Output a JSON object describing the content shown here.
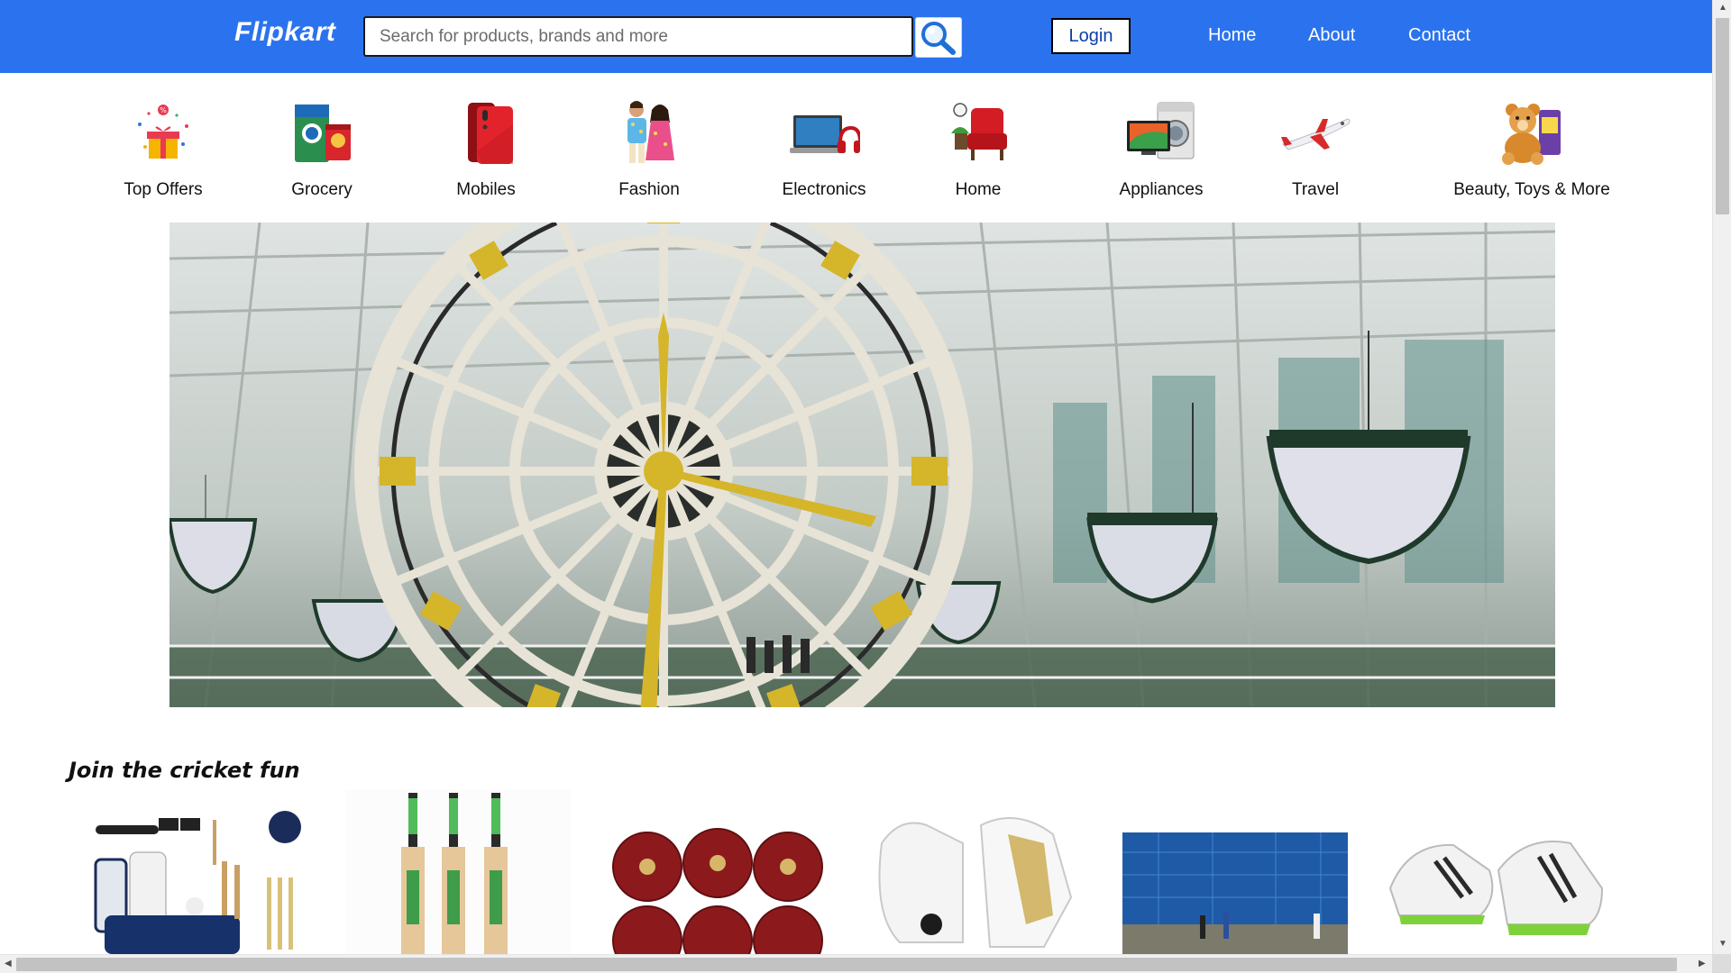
{
  "header": {
    "logo": "Flipkart",
    "search_placeholder": "Search for products, brands and more",
    "login_label": "Login",
    "nav": [
      "Home",
      "About",
      "Contact"
    ]
  },
  "categories": [
    {
      "label": "Top Offers",
      "icon": "gift-icon"
    },
    {
      "label": "Grocery",
      "icon": "grocery-icon"
    },
    {
      "label": "Mobiles",
      "icon": "mobile-phone-icon"
    },
    {
      "label": "Fashion",
      "icon": "fashion-people-icon"
    },
    {
      "label": "Electronics",
      "icon": "laptop-headphones-icon"
    },
    {
      "label": "Home",
      "icon": "armchair-icon"
    },
    {
      "label": "Appliances",
      "icon": "tv-washing-machine-icon"
    },
    {
      "label": "Travel",
      "icon": "airplane-icon"
    },
    {
      "label": "Beauty, Toys & More",
      "icon": "teddy-bear-icon"
    }
  ],
  "banner": {
    "image": "giant-clock-atrium-photo"
  },
  "cricket": {
    "title": "Join the cricket fun",
    "products": [
      {
        "image": "cricket-kit-photo"
      },
      {
        "image": "cricket-bats-photo"
      },
      {
        "image": "cricket-balls-photo"
      },
      {
        "image": "batting-gloves-photo"
      },
      {
        "image": "cricket-nets-photo"
      },
      {
        "image": "cricket-shoes-photo"
      }
    ]
  },
  "colors": {
    "header_bg": "#2b73ee",
    "login_text": "#0c3fa8"
  }
}
